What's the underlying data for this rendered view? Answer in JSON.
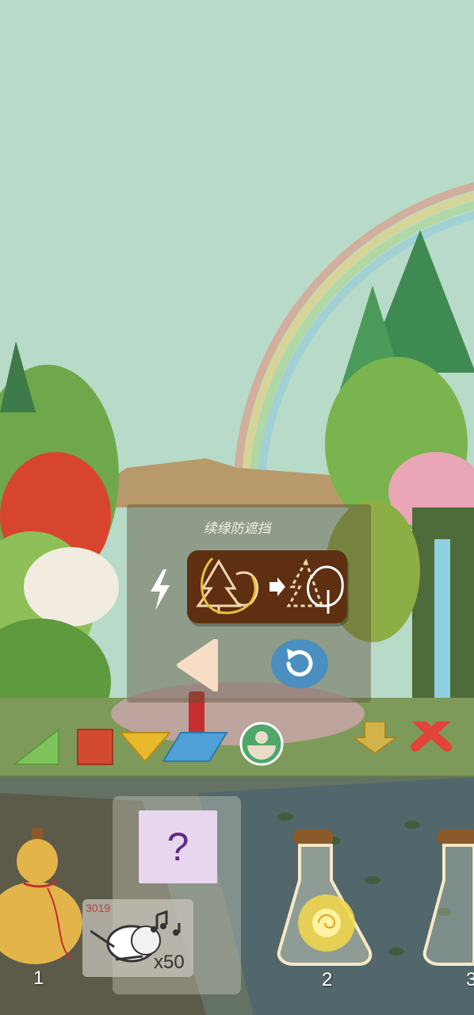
{
  "panel": {
    "title": "续缘防遮挡"
  },
  "shapes": [
    {
      "name": "green-triangle",
      "color": "#7cc45a"
    },
    {
      "name": "red-square",
      "color": "#d44a2e"
    },
    {
      "name": "yellow-triangle",
      "color": "#e9b92c"
    },
    {
      "name": "blue-parallelogram",
      "color": "#4ea0d6"
    },
    {
      "name": "green-ring",
      "color": "#4fa86a"
    }
  ],
  "inventory": {
    "slot1_number": "1",
    "slot2_number": "2",
    "slot3_number": "3",
    "mystery_label": "?",
    "bird_count": "3019",
    "bird_qty": "x50"
  },
  "colors": {
    "sky": "#b8dac8",
    "hint_card": "#5e2f10",
    "close_red": "#e0443a",
    "down_arrow": "#d4b24a",
    "reset_blue": "#4a8fbf"
  }
}
